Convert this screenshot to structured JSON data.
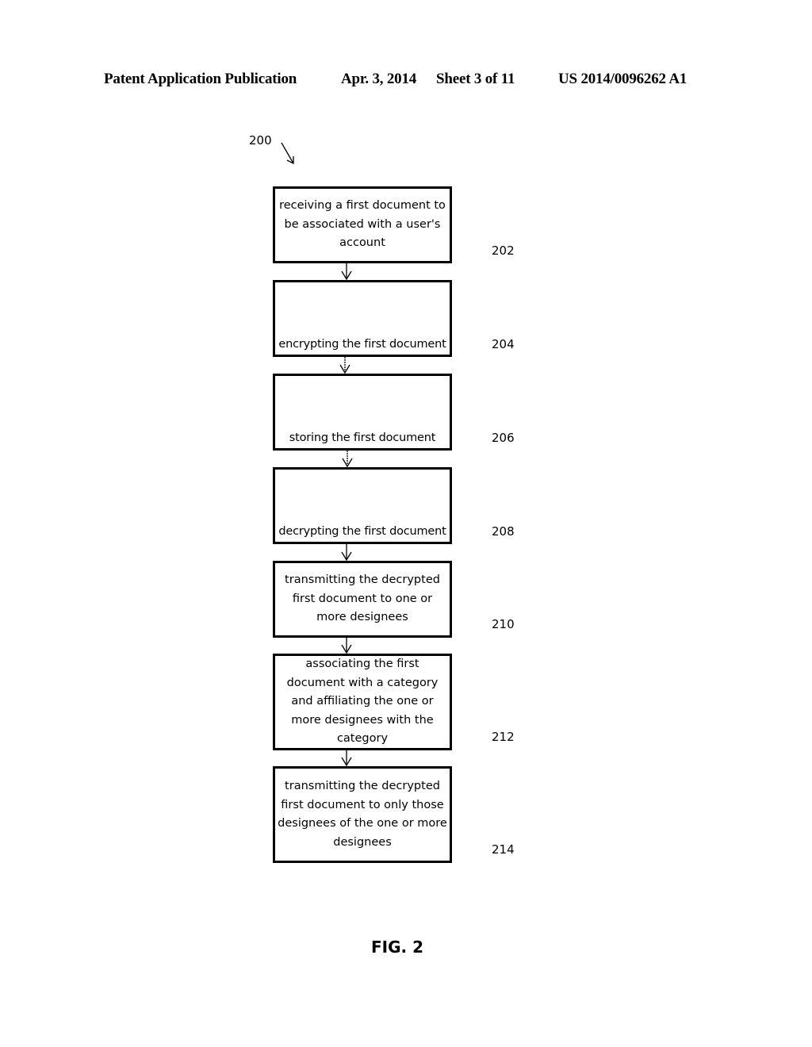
{
  "header": {
    "left": "Patent Application Publication",
    "date": "Apr. 3, 2014",
    "sheet": "Sheet 3 of 11",
    "pub_number": "US 2014/0096262 A1"
  },
  "figure": {
    "ref_number": "200",
    "caption": "FIG. 2"
  },
  "steps": [
    {
      "ref": "202",
      "text": "receiving a first document to be associated with a user's account"
    },
    {
      "ref": "204",
      "text": "encrypting the first document"
    },
    {
      "ref": "206",
      "text": "storing the first document"
    },
    {
      "ref": "208",
      "text": "decrypting the first document"
    },
    {
      "ref": "210",
      "text": "transmitting the decrypted first document to one or more designees"
    },
    {
      "ref": "212",
      "text": "associating the first document with a category and affiliating the one or more designees with the category"
    },
    {
      "ref": "214",
      "text": "transmitting the decrypted first document to only those designees of the one or more designees"
    }
  ]
}
